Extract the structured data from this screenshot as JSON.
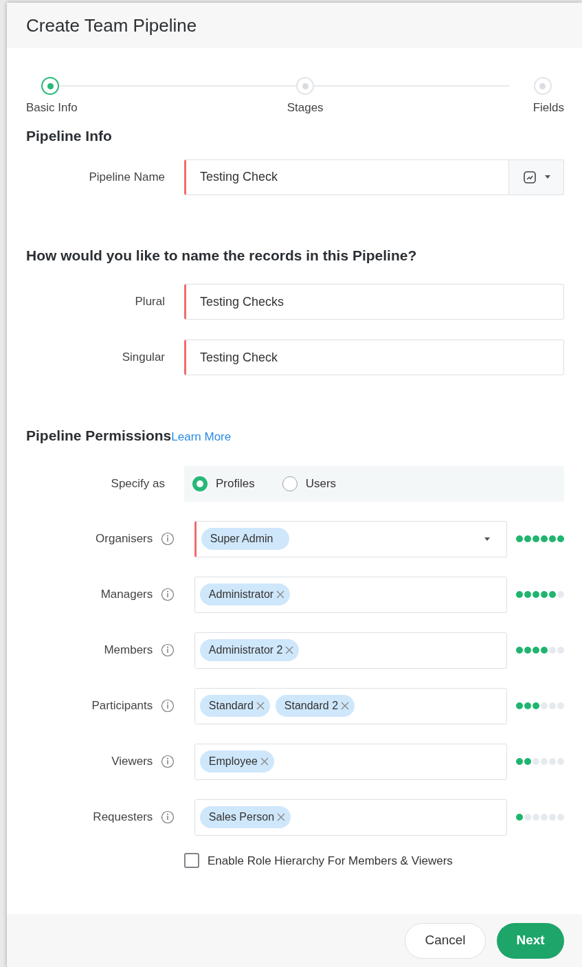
{
  "dialog": {
    "title": "Create Team Pipeline"
  },
  "steps": [
    {
      "label": "Basic Info",
      "selected": true
    },
    {
      "label": "Stages",
      "selected": false
    },
    {
      "label": "Fields",
      "selected": false
    }
  ],
  "pipeline_info": {
    "heading": "Pipeline Info",
    "field": {
      "label": "Pipeline Name",
      "value": "Testing Check",
      "required": true
    }
  },
  "naming": {
    "heading": "How would you like to name the records in this Pipeline?",
    "fields": [
      {
        "label": "Plural",
        "value": "Testing Checks",
        "required": true
      },
      {
        "label": "Singular",
        "value": "Testing Check",
        "required": true
      }
    ]
  },
  "permissions": {
    "heading": "Pipeline Permissions",
    "link": "Learn More",
    "specify_label": "Specify as",
    "options": [
      {
        "label": "Profiles",
        "selected": true
      },
      {
        "label": "Users",
        "selected": false
      }
    ],
    "roles": [
      {
        "label": "Organisers",
        "required": true,
        "dropdown": true,
        "stars": 6,
        "tags": [
          {
            "label": "Super Admin",
            "removable": false
          }
        ]
      },
      {
        "label": "Managers",
        "required": false,
        "dropdown": false,
        "stars": 5,
        "tags": [
          {
            "label": "Administrator",
            "removable": true
          }
        ]
      },
      {
        "label": "Members",
        "required": false,
        "dropdown": false,
        "stars": 4,
        "tags": [
          {
            "label": "Administrator 2",
            "removable": true
          }
        ]
      },
      {
        "label": "Participants",
        "required": false,
        "dropdown": false,
        "stars": 3,
        "tags": [
          {
            "label": "Standard",
            "removable": true
          },
          {
            "label": "Standard 2",
            "removable": true
          }
        ]
      },
      {
        "label": "Viewers",
        "required": false,
        "dropdown": false,
        "stars": 2,
        "tags": [
          {
            "label": "Employee",
            "removable": true
          }
        ]
      },
      {
        "label": "Requesters",
        "required": false,
        "dropdown": false,
        "stars": 1,
        "tags": [
          {
            "label": "Sales Person",
            "removable": true
          }
        ]
      }
    ],
    "hierarchy": {
      "label": "Enable Role Hierarchy For Members & Viewers",
      "checked": false
    }
  },
  "buttons": [
    {
      "label": "Cancel",
      "kind": "secondary"
    },
    {
      "label": "Next",
      "kind": "primary"
    }
  ]
}
